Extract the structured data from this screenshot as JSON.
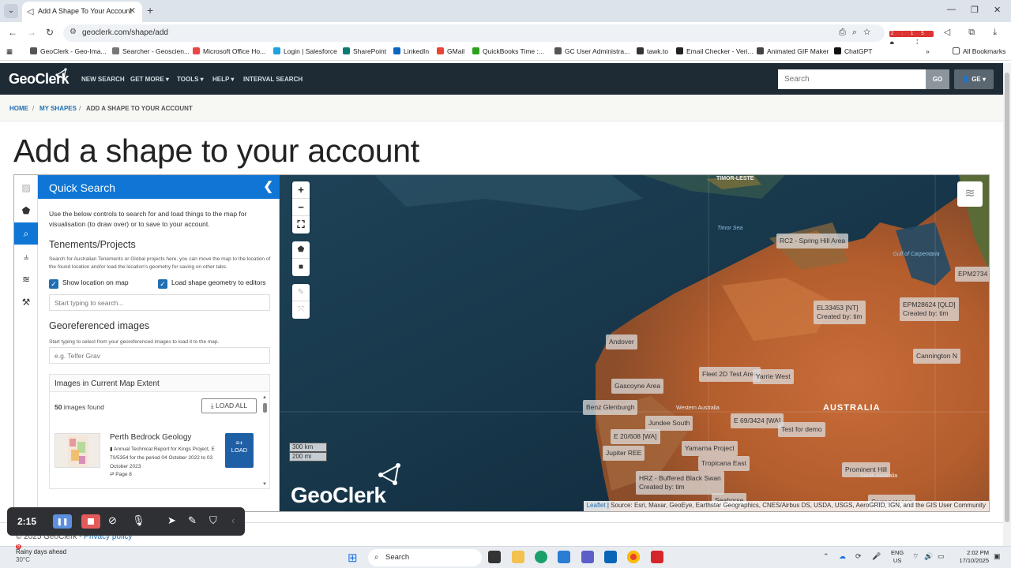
{
  "browser": {
    "tab_title": "Add A Shape To Your Account",
    "url": "geoclerk.com/shape/add",
    "bookmarks": [
      "GeoClerk - Geo-Ima...",
      "Searcher - Geoscien...",
      "Microsoft Office Ho...",
      "Login | Salesforce",
      "SharePoint",
      "LinkedIn",
      "GMail",
      "QuickBooks Time :...",
      "GC User Administra...",
      "tawk.to",
      "Email Checker - Veri...",
      "Animated GIF Maker",
      "ChatGPT"
    ],
    "all_bookmarks": "All Bookmarks",
    "badge_count": "2:15"
  },
  "header": {
    "logo": "GeoClerk",
    "nav": [
      "NEW SEARCH",
      "GET MORE",
      "TOOLS",
      "HELP",
      "INTERVAL SEARCH"
    ],
    "search_placeholder": "Search",
    "go_label": "GO",
    "user_label": "GE"
  },
  "breadcrumb": {
    "home": "HOME",
    "my_shapes": "MY SHAPES",
    "current": "ADD A SHAPE TO YOUR ACCOUNT",
    "sep": "/"
  },
  "page_title": "Add a shape to your account",
  "panel": {
    "title": "Quick Search",
    "intro": "Use the below controls to search for and load things to the map for visualisation (to draw over) or to save to your account.",
    "tenements": {
      "title": "Tenements/Projects",
      "help": "Search for Australian Tenements or Global projects here, you can move the map to the location of the found location and/or load the location's geometry for saving on other tabs.",
      "show_location": "Show location on map",
      "load_geometry": "Load shape geometry to editors",
      "placeholder": "Start typing to search..."
    },
    "georef": {
      "title": "Georeferenced images",
      "help": "Start typing to select from your georeferenced images to load it to the map.",
      "placeholder": "e.g. Telfer Grav"
    },
    "images": {
      "title": "Images in Current Map Extent",
      "count": "50",
      "count_suffix": "images found",
      "load_all": "LOAD ALL",
      "result": {
        "title": "Perth Bedrock Geology",
        "desc": "Annual Technical Report for Kings Project, E 70/5354 for the period 04 October 2022 to 03 October 2023",
        "page": "Page 8",
        "load": "LOAD"
      }
    }
  },
  "map": {
    "labels": [
      "RC2 - Spring Hill Area",
      "EPM2734",
      "EL33453 [NT]",
      "Created by: tim",
      "EPM28624 [QLD]",
      "Created by: tim",
      "Andover",
      "Cannington N",
      "Fleet 2D Test Area",
      "Gascoyne Area",
      "Yarrie West",
      "Benz Glenburgh",
      "Jundee South",
      "E 69/3424 [WA]",
      "Test for demo",
      "E 20/608 [WA]",
      "Yamarna Project",
      "Jupiter REE",
      "Tropicana East",
      "Prominent Hill",
      "HRZ - Buffered Black Swan",
      "Created by: tim",
      "Seahorse",
      "Carrapateena"
    ],
    "places": [
      "TIMOR-LESTE",
      "Timor Sea",
      "Gulf of Carpentaria",
      "Western Australia",
      "AUSTRALIA",
      "South Australia"
    ],
    "scale_km": "300 km",
    "scale_mi": "200 mi",
    "watermark": "GeoClerk",
    "attribution_link": "Leaflet",
    "attribution": "| Source: Esri, Maxar, GeoEye, Earthstar Geographics, CNES/Airbus DS, USDA, USGS, AeroGRID, IGN, and the GIS User Community"
  },
  "footer": {
    "copyright": "© 2025 GeoClerk - ",
    "privacy": "Privacy policy"
  },
  "recorder": {
    "time": "2:15"
  },
  "taskbar": {
    "weather_title": "Rainy days ahead",
    "weather_temp": "30°C",
    "search": "Search",
    "lang1": "ENG",
    "lang2": "US",
    "time": "2:02 PM",
    "date": "17/10/2025",
    "notif": "6"
  }
}
